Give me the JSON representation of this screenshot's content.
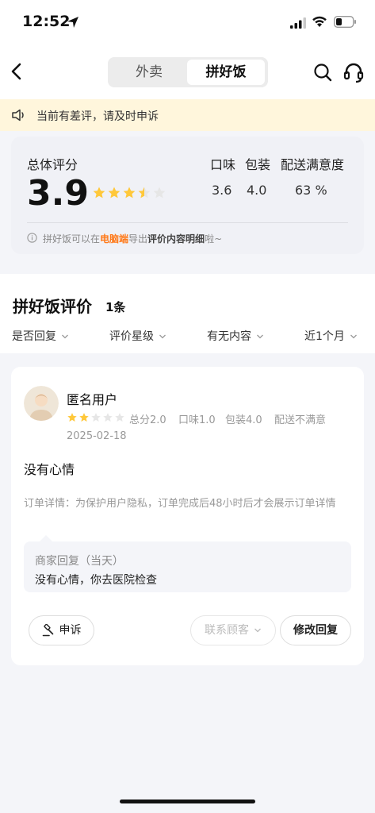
{
  "status_bar": {
    "time": "12:52"
  },
  "header": {
    "tabs": [
      {
        "label": "外卖",
        "active": false
      },
      {
        "label": "拼好饭",
        "active": true
      }
    ]
  },
  "notice": {
    "text": "当前有差评，请及时申诉"
  },
  "score_card": {
    "overall_label": "总体评分",
    "overall_score": "3.9",
    "overall_stars": 3.5,
    "metrics": [
      {
        "label": "口味",
        "value": "3.6"
      },
      {
        "label": "包装",
        "value": "4.0"
      },
      {
        "label": "配送满意度",
        "value": "63 %"
      }
    ],
    "tip": {
      "part1": "拼好饭可以在",
      "highlight": "电脑端",
      "part2": "导出",
      "bold": "评价内容明细",
      "part3": "啦~"
    }
  },
  "reviews_section": {
    "title": "拼好饭评价",
    "count": "1条",
    "filters": [
      "是否回复",
      "评价星级",
      "有无内容",
      "近1个月"
    ]
  },
  "review": {
    "username": "匿名用户",
    "stars": 2,
    "total": "总分2.0",
    "taste": "口味1.0",
    "packaging": "包装4.0",
    "delivery": "配送不满意",
    "date": "2025-02-18",
    "text": "没有心情",
    "order_detail": "订单详情：为保护用户隐私，订单完成后48小时后才会展示订单详情",
    "reply_title": "商家回复（当天）",
    "reply_text": "没有心情，你去医院检查"
  },
  "actions": {
    "complain": "申诉",
    "contact": "联系顾客",
    "edit_reply": "修改回复"
  },
  "colors": {
    "star": "#ffc83a",
    "star_empty": "#e6e6e6",
    "notice_bg": "#fff6dc",
    "highlight": "#ff7a1a"
  }
}
